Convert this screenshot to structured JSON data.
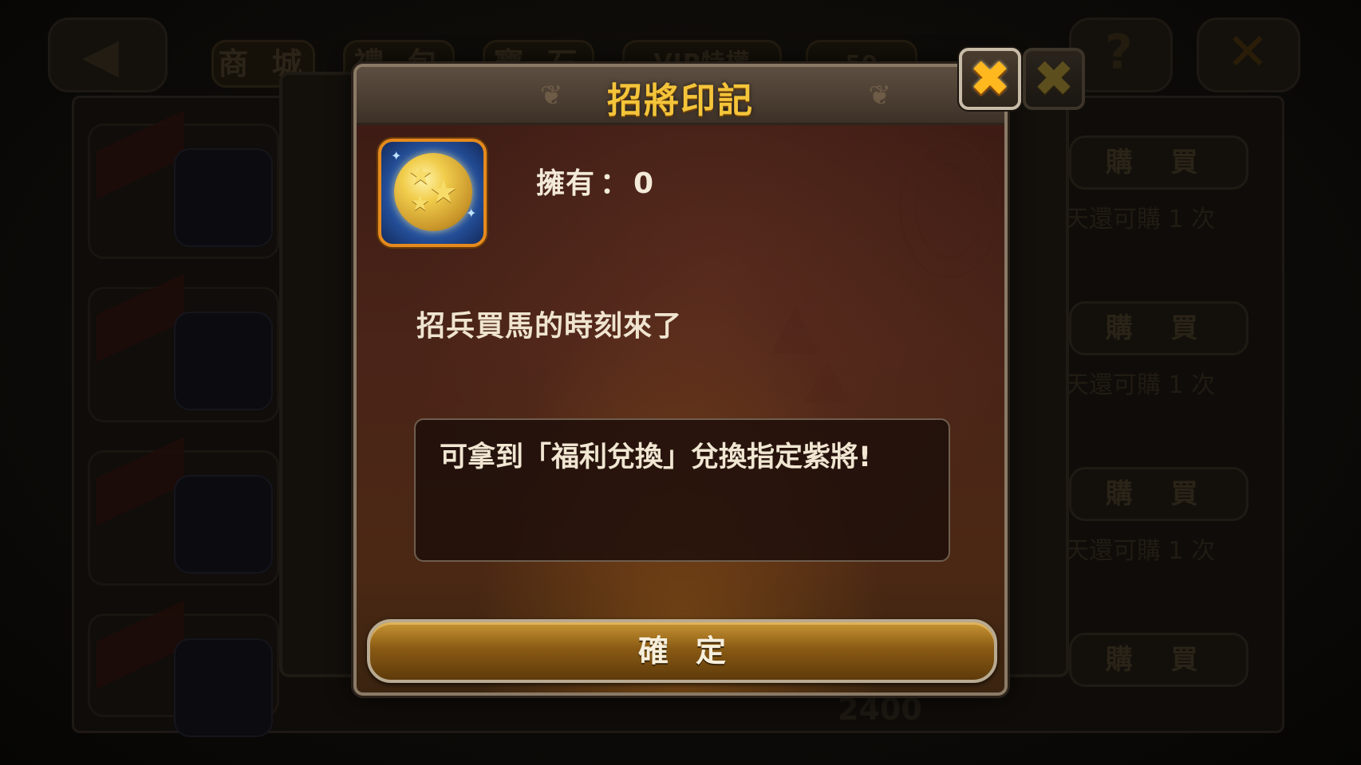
{
  "background": {
    "tabs": [
      "商 城",
      "禮 包",
      "寶 石",
      "VIP特權"
    ],
    "currency_value": "50",
    "buy_label": "購 買",
    "buy_note": "天還可購 1 次",
    "bottom_value": "2400"
  },
  "dialog": {
    "title": "招將印記",
    "item_icon": "star-coin-icon",
    "owned_label": "擁有",
    "owned_separator": "：",
    "owned_value": "0",
    "description": "招兵買馬的時刻來了",
    "info_text": "可拿到「福利兌換」兌換指定紫將!",
    "confirm_label": "確定",
    "close_icon": "close-icon"
  },
  "colors": {
    "title_gold": "#f4c43a",
    "close_orange": "#ffb81e",
    "item_frame": "#e58a1e",
    "button_gold": "#c99533"
  }
}
